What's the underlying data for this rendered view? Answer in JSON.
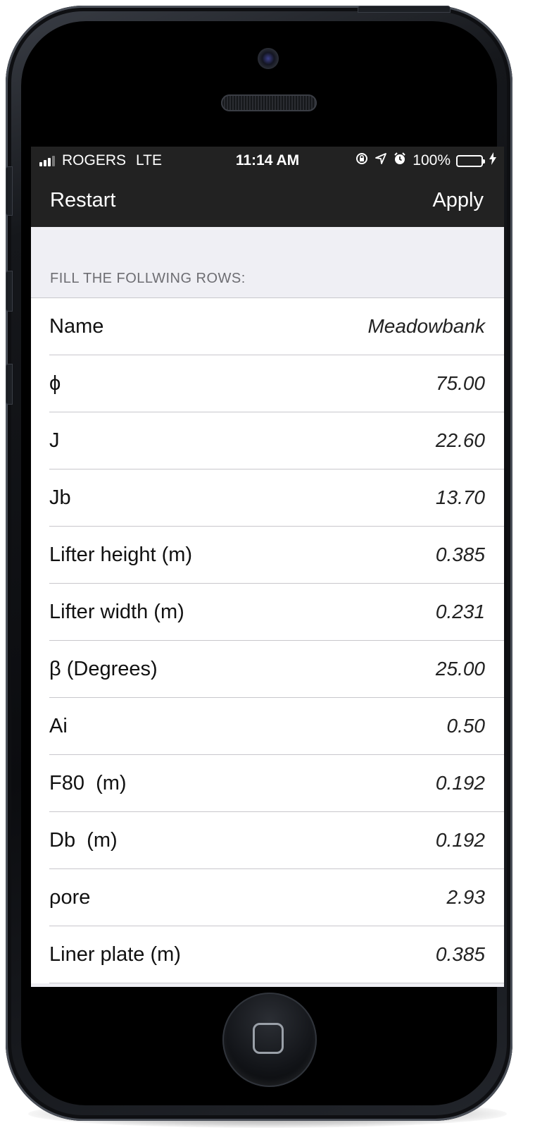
{
  "status_bar": {
    "carrier": "ROGERS",
    "network": "LTE",
    "time": "11:14 AM",
    "battery_percent": "100%",
    "battery_level": 1.0,
    "icons": [
      "signal-icon",
      "rotation-lock-icon",
      "location-arrow-icon",
      "alarm-icon",
      "battery-icon",
      "charging-bolt-icon"
    ]
  },
  "nav": {
    "left_label": "Restart",
    "right_label": "Apply"
  },
  "section": {
    "header": "FILL THE FOLLWING ROWS:"
  },
  "rows": [
    {
      "label": "Name",
      "value": "Meadowbank"
    },
    {
      "label": "ϕ",
      "value": "75.00"
    },
    {
      "label": "J",
      "value": "22.60"
    },
    {
      "label": "Jb",
      "value": "13.70"
    },
    {
      "label": "Lifter height (m)",
      "value": "0.385"
    },
    {
      "label": "Lifter width (m)",
      "value": "0.231"
    },
    {
      "label": "β (Degrees)",
      "value": "25.00"
    },
    {
      "label": "Ai",
      "value": "0.50"
    },
    {
      "label": "F80  (m)",
      "value": "0.192"
    },
    {
      "label": "Db  (m)",
      "value": "0.192"
    },
    {
      "label": "ρore",
      "value": "2.93"
    },
    {
      "label": "Liner plate (m)",
      "value": "0.385"
    }
  ],
  "colors": {
    "bar_background": "#222222",
    "screen_background": "#efeff4",
    "battery_fill": "#4cd964",
    "separator": "#c8c7cc"
  }
}
